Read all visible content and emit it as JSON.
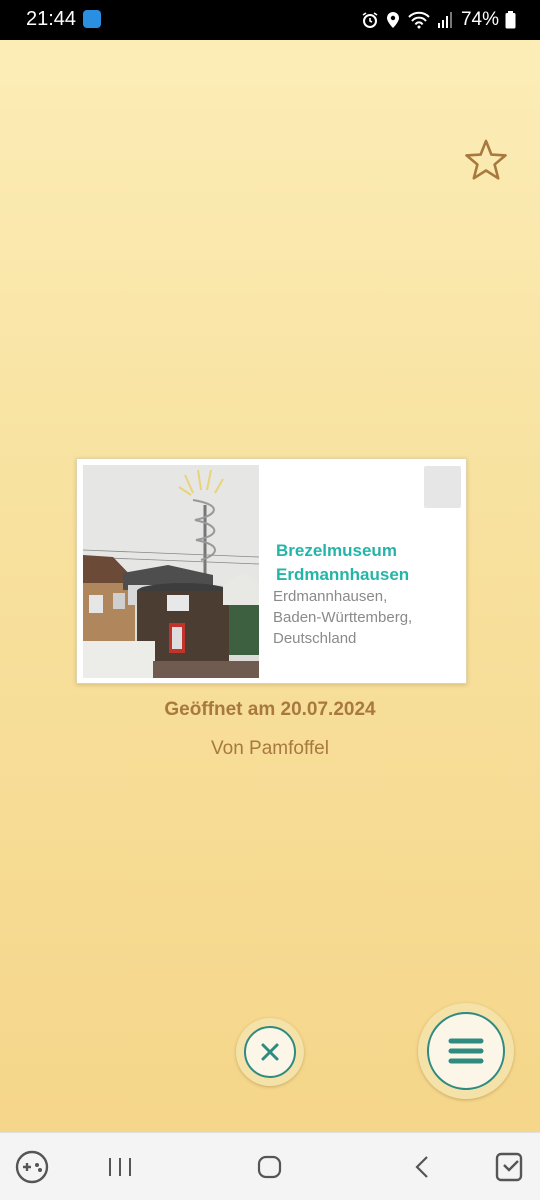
{
  "status_bar": {
    "time": "21:44",
    "battery_percent": "74%",
    "icons": [
      "app-notification-icon",
      "alarm-icon",
      "location-icon",
      "wifi-icon",
      "signal-icon",
      "battery-icon"
    ]
  },
  "card": {
    "name_line1": "Brezelmuseum",
    "name_line2": "Erdmannhausen",
    "address_lines": [
      "Erdmannhausen,",
      "Baden-Württemberg,",
      "Deutschland"
    ]
  },
  "info": {
    "opened": "Geöffnet am 20.07.2024",
    "by": "Von Pamfoffel"
  },
  "colors": {
    "accent_teal": "#25b5a8",
    "text_brown": "#a8793f",
    "background": "#f8e2a0"
  },
  "buttons": {
    "favorite": "star-icon",
    "close": "close-icon",
    "menu": "menu-icon"
  },
  "nav_bar": {
    "items": [
      "game-launcher-icon",
      "recents-icon",
      "home-icon",
      "back-icon",
      "screenshot-icon"
    ]
  }
}
